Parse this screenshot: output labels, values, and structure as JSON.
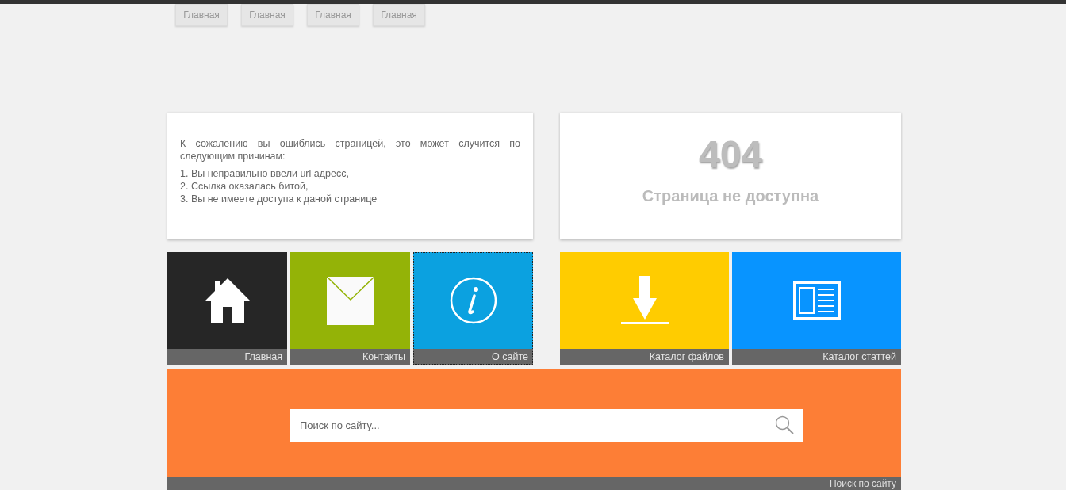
{
  "nav": [
    {
      "label": "Главная"
    },
    {
      "label": "Главная"
    },
    {
      "label": "Главная"
    },
    {
      "label": "Главная"
    }
  ],
  "message": {
    "intro": "К сожалению вы ошиблись страницей, это может случится по следующим причинам:",
    "reasons": [
      "1. Вы неправильно ввели url адресс,",
      "2. Ссылка оказалась битой,",
      "3. Вы не имеете доступа к даной странице"
    ]
  },
  "error": {
    "code": "404",
    "title": "Страница не доступна"
  },
  "tiles_left": [
    {
      "kind": "home",
      "label": "Главная",
      "color": "#262626",
      "focused": false
    },
    {
      "kind": "mail",
      "label": "Контакты",
      "color": "#94b307",
      "focused": false
    },
    {
      "kind": "info",
      "label": "О сайте",
      "color": "#0ba1e0",
      "focused": true
    }
  ],
  "tiles_right": [
    {
      "kind": "download",
      "label": "Каталог файлов",
      "color": "#ffcc00",
      "focused": false
    },
    {
      "kind": "articles",
      "label": "Каталог статтей",
      "color": "#0894ff",
      "focused": false
    }
  ],
  "search": {
    "placeholder": "Поиск по сайту...",
    "label": "Поиск по сайту"
  }
}
